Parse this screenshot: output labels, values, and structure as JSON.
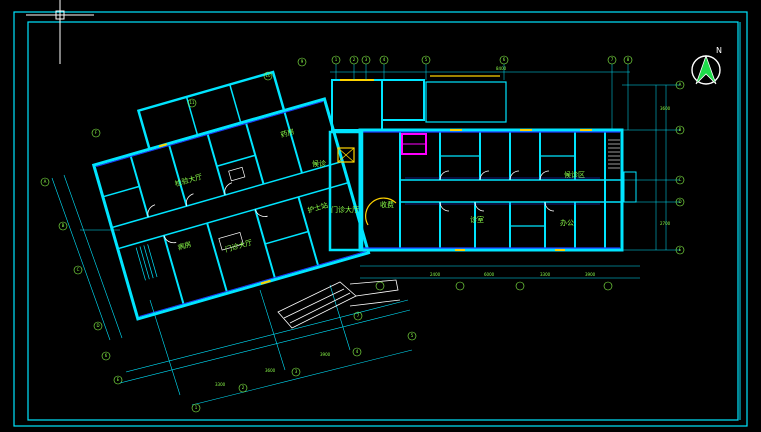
{
  "app": {
    "background": "#000000",
    "frame_color": "#00e5ff",
    "wall_color": "#00e5ff",
    "secondary_color": "#1e3cff",
    "text_color": "#8cff4a",
    "accent_magenta": "#ff00ff",
    "accent_yellow": "#ffd400"
  },
  "north_arrow": {
    "letter": "N",
    "icon": "north-arrow-icon"
  },
  "cursor": {
    "icon": "crosshair-cursor-icon"
  },
  "room_labels": [
    "门诊大厅",
    "检验大厅",
    "药房",
    "收费",
    "候诊",
    "候诊区",
    "病房",
    "办公",
    "诊室",
    "护士站"
  ],
  "grid_bubbles": {
    "top": [
      "1",
      "2",
      "3",
      "4",
      "5",
      "6",
      "7",
      "8",
      "9",
      "10",
      "11"
    ],
    "left": [
      "A",
      "B",
      "C",
      "D",
      "E",
      "F"
    ],
    "bottom": [
      "1",
      "2",
      "3",
      "4",
      "5",
      "6",
      "7"
    ],
    "right": [
      "A",
      "B",
      "C",
      "D",
      "E"
    ]
  },
  "dimensions": [
    "3300",
    "3600",
    "3900",
    "2400",
    "6000",
    "3300",
    "3900",
    "8400",
    "3600",
    "2700"
  ]
}
